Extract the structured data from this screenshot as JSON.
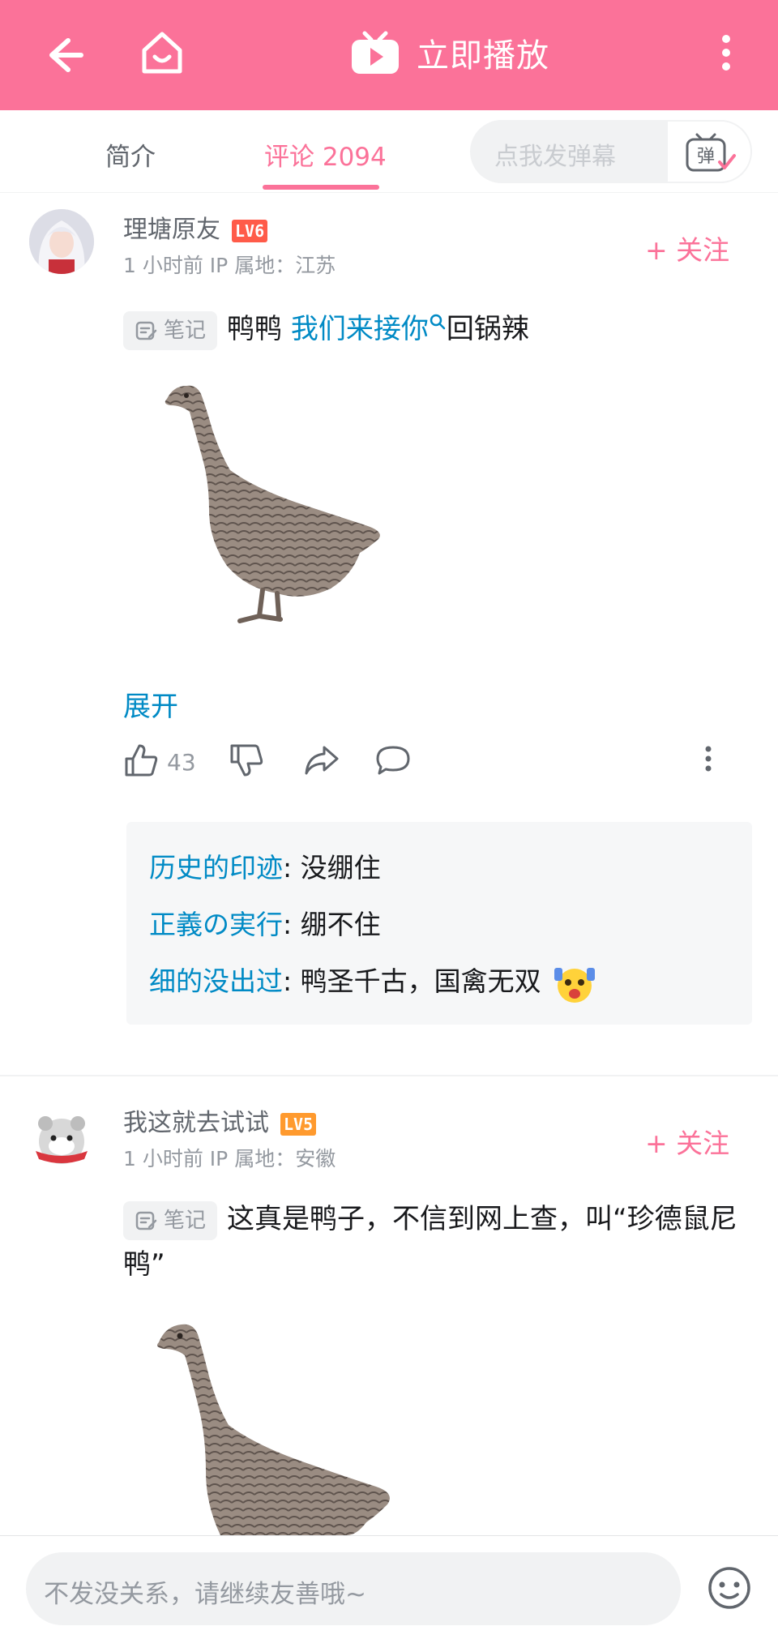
{
  "topbar": {
    "play_label": "立即播放"
  },
  "tabs": {
    "intro": "简介",
    "comments": "评论 2094",
    "danmaku_placeholder": "点我发弹幕",
    "danmaku_button": "弹"
  },
  "comments": [
    {
      "username": "理塘原友",
      "level": "LV6",
      "meta": "1 小时前  IP 属地：江苏",
      "follow_label": "+ 关注",
      "note_label": "笔记",
      "text_before": "鸭鸭 ",
      "link_text": "我们来接你",
      "text_after": "回锅辣",
      "expand": "展开",
      "likes": "43",
      "replies": [
        {
          "name": "历史的印迹",
          "text": ": 没绷住"
        },
        {
          "name": "正義の実行",
          "text": ": 绷不住"
        },
        {
          "name": "细的没出过",
          "text": ": 鸭圣千古，国禽无双"
        }
      ]
    },
    {
      "username": "我这就去试试",
      "level": "LV5",
      "meta": "1 小时前  IP 属地：安徽",
      "follow_label": "+ 关注",
      "note_label": "笔记",
      "text": "这真是鸭子，不信到网上查，叫“珍德鼠尼鸭”"
    }
  ],
  "bottom": {
    "placeholder": "不发没关系，请继续友善哦~"
  },
  "colors": {
    "brand_pink": "#fb7299",
    "link_blue": "#008ac5",
    "lv6": "#ff5b49",
    "lv5": "#ff9a2e"
  }
}
